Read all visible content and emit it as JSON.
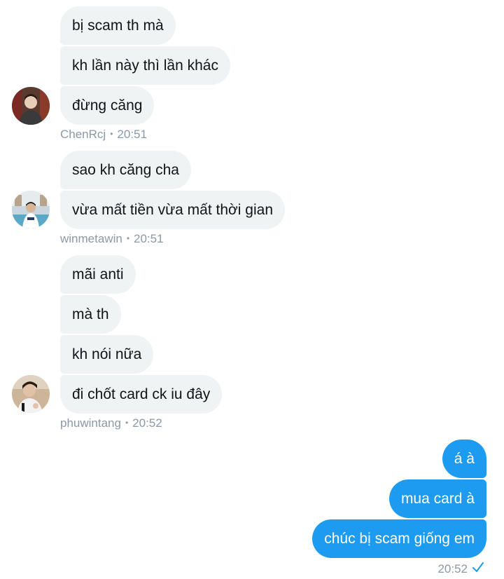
{
  "messages_group1": {
    "items": [
      "bị scam th mà",
      "kh lần này thì lần khác",
      "đừng căng"
    ],
    "sender": "ChenRcj",
    "time": "20:51"
  },
  "messages_group2": {
    "items": [
      "sao kh căng cha",
      "vừa mất tiền vừa mất thời gian"
    ],
    "sender": "winmetawin",
    "time": "20:51"
  },
  "messages_group3": {
    "items": [
      "mãi anti",
      "mà th",
      "kh nói nữa",
      "đi chốt card ck iu đây"
    ],
    "sender": "phuwintang",
    "time": "20:52"
  },
  "sent_group": {
    "items": [
      "á à",
      "mua card à",
      "chúc bị scam giống em"
    ],
    "time": "20:52",
    "status_icon": "check-icon"
  },
  "separator": "•",
  "colors": {
    "incoming_bubble": "#eff3f4",
    "outgoing_bubble": "#1d9bf0",
    "meta_text": "#8b98a5"
  }
}
